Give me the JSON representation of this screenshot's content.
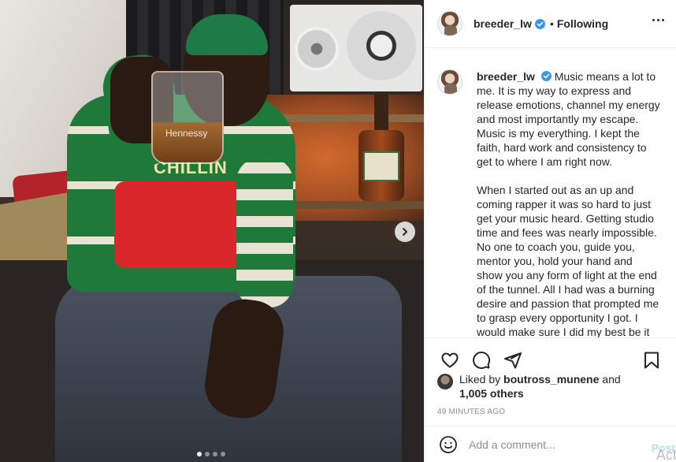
{
  "post": {
    "image_alt": "Man in green Christmas sweater raising a Hennessy glass",
    "sweater_text": "CHILLIN",
    "glass_text": "Hennessy",
    "carousel": {
      "total": 4,
      "current": 1
    }
  },
  "header": {
    "username": "breeder_lw",
    "bullet": "•",
    "follow_status": "Following"
  },
  "caption": {
    "username": "breeder_lw",
    "paragraph_1": "Music means a lot to me. It is my way to express and release emotions, channel my energy and most importantly my escape. Music is my everything. I kept the faith, hard work and consistency to get to where I am right now.",
    "paragraph_2": "When I started out as an up and coming rapper it was so hard to just get your music heard. Getting studio time and fees was nearly impossible. No one to coach you, guide you, mentor you, hold your hand and show you any form of light at the end of the tunnel. All I had was a burning desire and passion that prompted me to grasp every opportunity I got. I would make sure I did my best be it in"
  },
  "likes": {
    "prefix": "Liked by",
    "user": "boutross_munene",
    "and": "and",
    "others": "1,005 others"
  },
  "time": "49 MINUTES AGO",
  "comment": {
    "placeholder": "Add a comment...",
    "post_label": "Post",
    "overlay_text": "Acti"
  },
  "colors": {
    "verified": "#3897f0",
    "post_button": "#b2dffc",
    "muted": "#8e8e8e"
  }
}
